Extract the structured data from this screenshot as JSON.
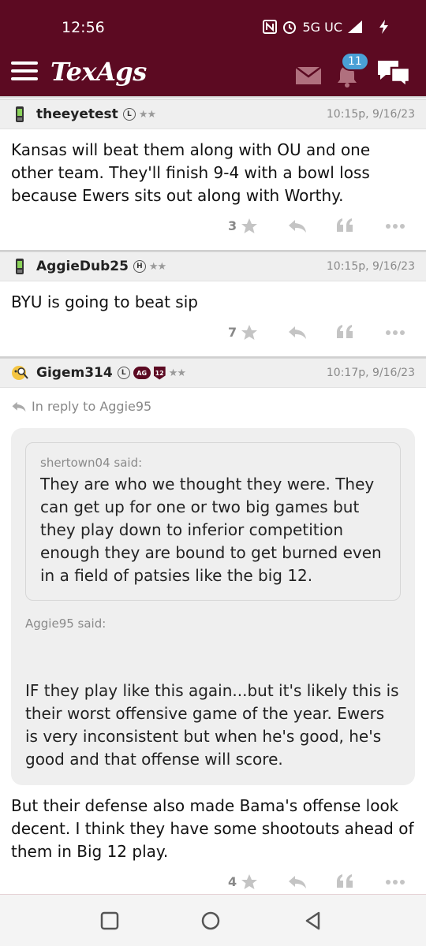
{
  "status": {
    "time": "12:56",
    "network": "5G UC"
  },
  "app": {
    "logo": "TexAgs",
    "notification_count": "11"
  },
  "posts": [
    {
      "username": "theeyetest",
      "tag": "L",
      "stars": "★★",
      "timestamp": "10:15p, 9/16/23",
      "body": "Kansas will beat them along with OU and one other team. They'll finish 9-4 with a bowl loss because Ewers sits out along with Worthy.",
      "star_count": "3"
    },
    {
      "username": "AggieDub25",
      "tag": "H",
      "stars": "★★",
      "timestamp": "10:15p, 9/16/23",
      "body": "BYU is going to beat sip",
      "star_count": "7"
    },
    {
      "username": "Gigem314",
      "tag": "L",
      "tag_ag": "AG",
      "tag_shield": "12",
      "stars": "★★",
      "timestamp": "10:17p, 9/16/23",
      "in_reply_to": "In reply to Aggie95",
      "inner_quote_author": "shertown04 said:",
      "inner_quote_text": "They are who we thought they were. They can get up for one or two big games but they play down to inferior competition enough they are bound to get burned even in a field of patsies like the big 12.",
      "outer_quote_author": "Aggie95 said:",
      "outer_quote_text": "IF they play like this again...but it's likely this is their worst offensive game of the year. Ewers is very inconsistent but when he's good, he's good and that offense will score.",
      "body": "But their defense also made Bama's offense look decent. I think they have some shootouts ahead of them in Big 12 play.",
      "star_count": "4"
    }
  ],
  "colors": {
    "brand": "#5c0a22",
    "badge": "#4aa0d6",
    "header_bg": "#efefef"
  }
}
